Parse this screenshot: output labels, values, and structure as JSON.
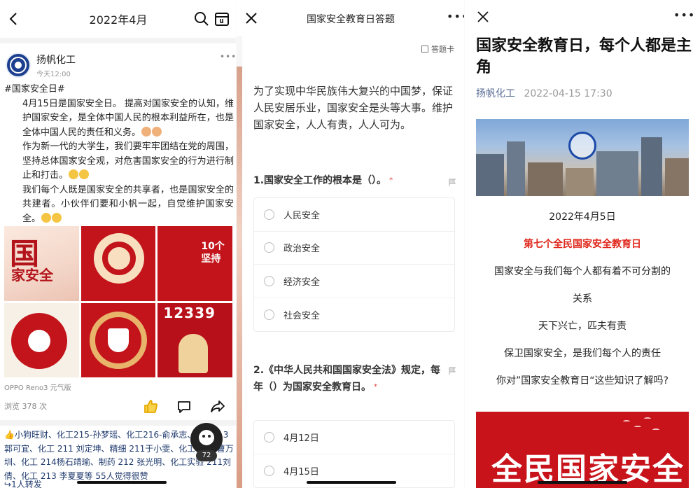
{
  "panel1": {
    "header": {
      "title": "2022年4月"
    },
    "post": {
      "author": "扬帆化工",
      "time": "今天12:00",
      "hashtag": "#国家安全日#",
      "para1": "4月15日是国家安全日。 提高对国家安全的认知，维护国家安全，是全体中国人民的根本利益所在，也是全体中国人民的责任和义务。",
      "para2": "作为新一代的大学生，我们要牢牢团结在党的周围，坚持总体国家安全观，对危害国家安全的行为进行制止和打击。",
      "para3": "我们每个人既是国家安全的共享者，也是国家安全的共建者。小伙伴们要和小帆一起，自觉维护国家安全。",
      "images": [
        {
          "text1": "国",
          "text2": "家安全"
        },
        {
          "text1": ""
        },
        {
          "text1": "10个坚持"
        },
        {
          "text1": ""
        },
        {
          "text1": ""
        },
        {
          "text1": "12339"
        }
      ],
      "device": "OPPO Reno3 元气版",
      "views": "浏览 378 次"
    },
    "likes_text": "小狗旺财、化工215-孙梦瑶、化工216-俞承志、制药213 郭可宜、化工 211 刘定坤、精细 211于小雯、化工 215 曹万圳、化工 214杨石靖瑜、制药 212 张光明、化工实验 211刘倩、化工 213 李夏夏等 55人觉得很赞",
    "forward": "1人转发",
    "float_count": "72"
  },
  "panel2": {
    "header": {
      "title": "国家安全教育日答题"
    },
    "answer_card": "答题卡",
    "intro": "为了实现中华民族伟大复兴的中国梦，保证人民安居乐业，国家安全是头等大事。维护国家安全，人人有责，人人可为。",
    "questions": [
      {
        "text": "1.国家安全工作的根本是（）。",
        "required_mark": "*",
        "options": [
          "人民安全",
          "政治安全",
          "经济安全",
          "社会安全"
        ]
      },
      {
        "text": "2.《中华人民共和国国家安全法》规定，每年（）为国家安全教育日。",
        "required_mark": "*",
        "options": [
          "4月12日",
          "4月15日"
        ]
      }
    ]
  },
  "panel3": {
    "title": "国家安全教育日，每个人都是主角",
    "author": "扬帆化工",
    "date": "2022-04-15 17:30",
    "lines": [
      "2022年4月5日",
      "第七个全民国家安全教育日",
      "国家安全与我们每个人都有着不可分割的",
      "关系",
      "天下兴亡，匹夫有责",
      "保卫国家安全，是我们每个人的责任",
      "你对”国家安全教育日“这些知识了解吗?"
    ],
    "poster_text": "全民国家安全"
  },
  "colors": {
    "accent_red": "#e0261b",
    "link_blue": "#576b95",
    "poster_red": "#c8131b"
  }
}
